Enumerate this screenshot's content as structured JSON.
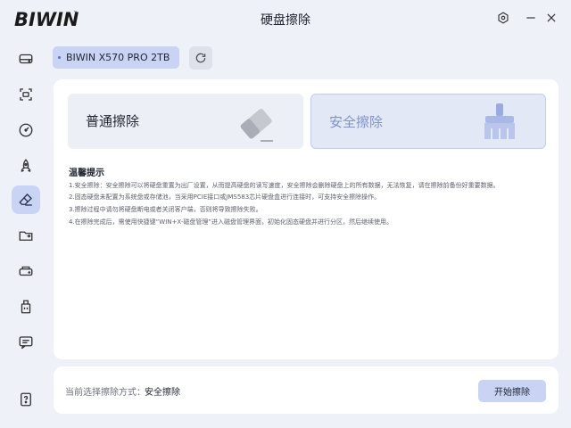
{
  "app": {
    "logo_text": "BIWIN",
    "title": "硬盘擦除",
    "window_buttons": [
      "settings-icon",
      "minimize-icon",
      "close-icon"
    ]
  },
  "sidebar": {
    "items": [
      {
        "name": "disk-icon",
        "active": false
      },
      {
        "name": "scan-icon",
        "active": false
      },
      {
        "name": "speed-gauge-icon",
        "active": false
      },
      {
        "name": "rocket-icon",
        "active": false
      },
      {
        "name": "eraser-icon",
        "active": true
      },
      {
        "name": "folder-transfer-icon",
        "active": false
      },
      {
        "name": "drive-clone-icon",
        "active": false
      },
      {
        "name": "usb-icon",
        "active": false
      },
      {
        "name": "message-icon",
        "active": false
      }
    ],
    "help_icon": "help-icon"
  },
  "device": {
    "selected": "BIWIN X570 PRO 2TB",
    "refresh_icon": "refresh-icon"
  },
  "options": {
    "normal": {
      "label": "普通擦除",
      "icon": "eraser-icon"
    },
    "secure": {
      "label": "安全擦除",
      "icon": "broom-icon",
      "selected": true
    }
  },
  "tips": {
    "title": "温馨提示",
    "items": [
      "1.安全擦除：安全擦除可以将硬盘重置为出厂设置，从而提高硬盘的读写速度，安全擦除会删除硬盘上的所有数据，无法恢复，请在擦除前备份好重要数据。",
      "2.固态硬盘未配置为系统盘或存储池，当采用PCIE接口或JMS583芯片硬盘盒进行连接时，可支持安全擦除操作。",
      "3.擦除过程中请勿将硬盘断电或者关闭客户端，否则将导致擦除失败。",
      "4.在擦除完成后，需使用快捷键“WIN+X-磁盘管理”进入磁盘管理界面，初始化固态硬盘并进行分区，然后继续使用。"
    ]
  },
  "footer": {
    "mode_label": "当前选择擦除方式：",
    "mode_value": "安全擦除",
    "start_button": "开始擦除"
  },
  "colors": {
    "accent": "#c9d4f4",
    "background": "#eef1f7",
    "secure_text": "#7f91cf"
  }
}
